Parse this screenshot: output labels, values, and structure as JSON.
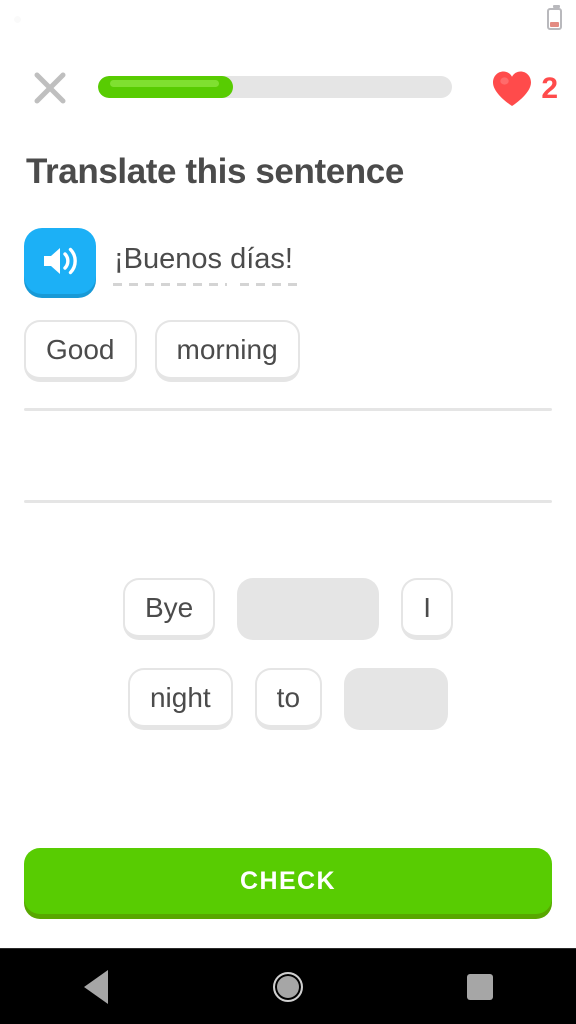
{
  "status_bar": {
    "battery_icon": "battery-low-icon",
    "notification_dot": "notification-dot"
  },
  "header": {
    "close_icon": "close-x-icon",
    "progress": {
      "percent": 38,
      "fill_color": "#58cc02",
      "track_color": "#e5e5e5"
    },
    "hearts": {
      "icon": "heart-icon",
      "count": "2",
      "color": "#ff4b4b"
    }
  },
  "exercise": {
    "title": "Translate this sentence",
    "speaker_icon": "speaker-volume-icon",
    "speaker_color": "#1cb0f6",
    "prompt_text": "¡Buenos días!",
    "prompt_words_underlined": [
      "Buenos",
      "días"
    ]
  },
  "answer": {
    "tiles": [
      {
        "label": "Good"
      },
      {
        "label": "morning"
      }
    ]
  },
  "word_bank": {
    "rows": [
      [
        {
          "label": "Bye",
          "used": false
        },
        {
          "label": "",
          "used": true,
          "width": 142
        },
        {
          "label": "I",
          "used": false
        }
      ],
      [
        {
          "label": "night",
          "used": false
        },
        {
          "label": "to",
          "used": false
        },
        {
          "label": "",
          "used": true,
          "width": 104
        }
      ]
    ]
  },
  "footer": {
    "check_label": "CHECK",
    "check_color": "#58cc02"
  },
  "navbar": {
    "back_icon": "triangle-back-icon",
    "home_icon": "circle-home-icon",
    "recents_icon": "square-recents-icon"
  }
}
